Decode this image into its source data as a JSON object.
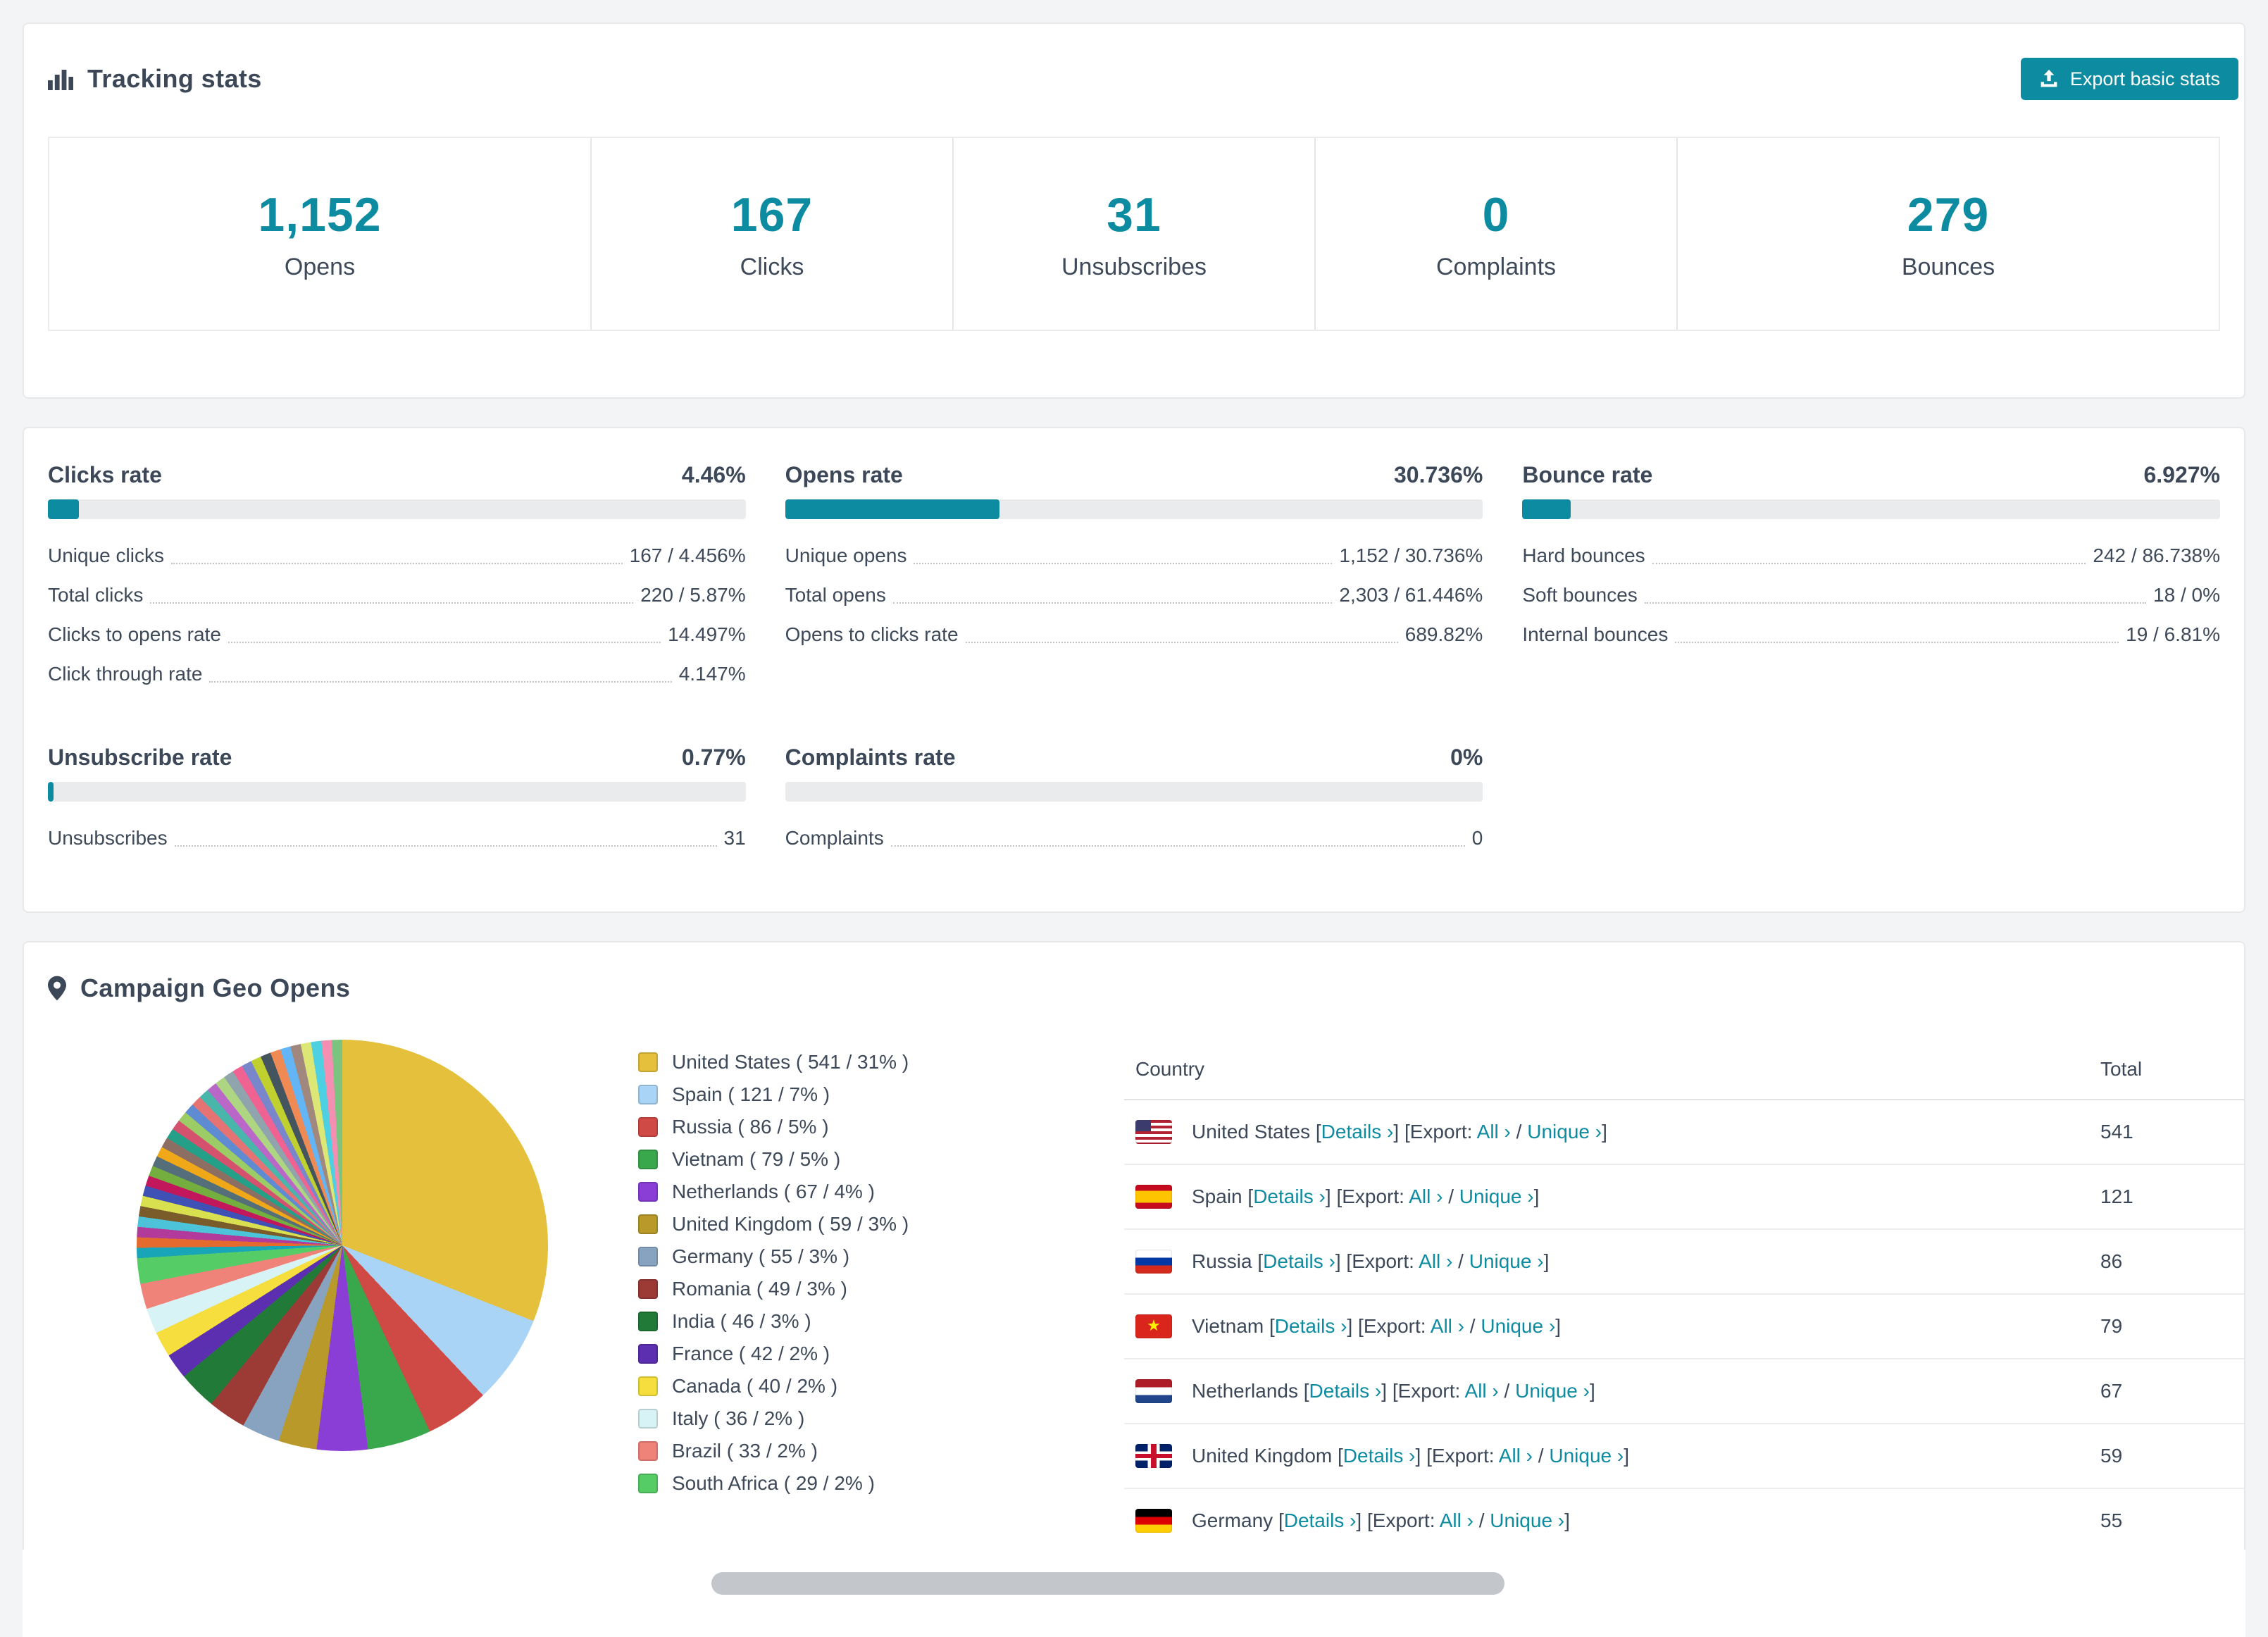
{
  "accent": "#0d8ba1",
  "tracking": {
    "title": "Tracking stats",
    "export_button": "Export basic stats",
    "metrics": [
      {
        "value": "1,152",
        "label": "Opens"
      },
      {
        "value": "167",
        "label": "Clicks"
      },
      {
        "value": "31",
        "label": "Unsubscribes"
      },
      {
        "value": "0",
        "label": "Complaints"
      },
      {
        "value": "279",
        "label": "Bounces"
      }
    ]
  },
  "rates": [
    {
      "title": "Clicks rate",
      "value": "4.46%",
      "fill": "4.46%",
      "rows": [
        {
          "label": "Unique clicks",
          "value": "167 / 4.456%"
        },
        {
          "label": "Total clicks",
          "value": "220 / 5.87%"
        },
        {
          "label": "Clicks to opens rate",
          "value": "14.497%"
        },
        {
          "label": "Click through rate",
          "value": "4.147%"
        }
      ]
    },
    {
      "title": "Opens rate",
      "value": "30.736%",
      "fill": "30.736%",
      "rows": [
        {
          "label": "Unique opens",
          "value": "1,152 / 30.736%"
        },
        {
          "label": "Total opens",
          "value": "2,303 / 61.446%"
        },
        {
          "label": "Opens to clicks rate",
          "value": "689.82%"
        }
      ]
    },
    {
      "title": "Bounce rate",
      "value": "6.927%",
      "fill": "6.927%",
      "rows": [
        {
          "label": "Hard bounces",
          "value": "242 / 86.738%"
        },
        {
          "label": "Soft bounces",
          "value": "18 / 0%"
        },
        {
          "label": "Internal bounces",
          "value": "19 / 6.81%"
        }
      ]
    },
    {
      "title": "Unsubscribe rate",
      "value": "0.77%",
      "fill": "0.77%",
      "rows": [
        {
          "label": "Unsubscribes",
          "value": "31"
        }
      ]
    },
    {
      "title": "Complaints rate",
      "value": "0%",
      "fill": "0%",
      "rows": [
        {
          "label": "Complaints",
          "value": "0"
        }
      ]
    }
  ],
  "geo": {
    "title": "Campaign Geo Opens",
    "chart_data": {
      "type": "pie",
      "title": "Campaign Geo Opens",
      "slices": [
        {
          "label": "United States",
          "count": 541,
          "pct": 31,
          "color": "#e4c03c"
        },
        {
          "label": "Spain",
          "count": 121,
          "pct": 7,
          "color": "#aad4f5"
        },
        {
          "label": "Russia",
          "count": 86,
          "pct": 5,
          "color": "#cf4a45"
        },
        {
          "label": "Vietnam",
          "count": 79,
          "pct": 5,
          "color": "#39a84d"
        },
        {
          "label": "Netherlands",
          "count": 67,
          "pct": 4,
          "color": "#8a3ed6"
        },
        {
          "label": "United Kingdom",
          "count": 59,
          "pct": 3,
          "color": "#b8992a"
        },
        {
          "label": "Germany",
          "count": 55,
          "pct": 3,
          "color": "#87a3c0"
        },
        {
          "label": "Romania",
          "count": 49,
          "pct": 3,
          "color": "#9c3b35"
        },
        {
          "label": "India",
          "count": 46,
          "pct": 3,
          "color": "#227a39"
        },
        {
          "label": "France",
          "count": 42,
          "pct": 2,
          "color": "#5b2fb0"
        },
        {
          "label": "Canada",
          "count": 40,
          "pct": 2,
          "color": "#f5de3d"
        },
        {
          "label": "Italy",
          "count": 36,
          "pct": 2,
          "color": "#d8f3f5"
        },
        {
          "label": "Brazil",
          "count": 33,
          "pct": 2,
          "color": "#f08379"
        },
        {
          "label": "South Africa",
          "count": 29,
          "pct": 2,
          "color": "#55cc66"
        }
      ],
      "other": {
        "pct_total": 26,
        "colors": [
          "#18a5b8",
          "#e46a2e",
          "#b23a9b",
          "#4cc3d9",
          "#7a5c2b",
          "#d9e04f",
          "#3f51b5",
          "#c2185b",
          "#74ae3f",
          "#546e7a",
          "#f0a818",
          "#8d6e63",
          "#24a089",
          "#d4526e",
          "#9ccc65",
          "#5e8bd1",
          "#e57373",
          "#49b6ac",
          "#ba68c8",
          "#aed581",
          "#90a4ae",
          "#f06292",
          "#7986cb",
          "#c0d12f",
          "#45555f",
          "#f08a55",
          "#64b5f6",
          "#a1887f",
          "#dce775",
          "#4dd0e1",
          "#f48fb1",
          "#7bc47f"
        ]
      }
    },
    "legend": [
      {
        "text": "United States ( 541 / 31% )",
        "color": "#e4c03c"
      },
      {
        "text": "Spain ( 121 / 7% )",
        "color": "#aad4f5"
      },
      {
        "text": "Russia ( 86 / 5% )",
        "color": "#cf4a45"
      },
      {
        "text": "Vietnam ( 79 / 5% )",
        "color": "#39a84d"
      },
      {
        "text": "Netherlands ( 67 / 4% )",
        "color": "#8a3ed6"
      },
      {
        "text": "United Kingdom ( 59 / 3% )",
        "color": "#b8992a"
      },
      {
        "text": "Germany ( 55 / 3% )",
        "color": "#87a3c0"
      },
      {
        "text": "Romania ( 49 / 3% )",
        "color": "#9c3b35"
      },
      {
        "text": "India ( 46 / 3% )",
        "color": "#227a39"
      },
      {
        "text": "France ( 42 / 2% )",
        "color": "#5b2fb0"
      },
      {
        "text": "Canada ( 40 / 2% )",
        "color": "#f5de3d"
      },
      {
        "text": "Italy ( 36 / 2% )",
        "color": "#d8f3f5"
      },
      {
        "text": "Brazil ( 33 / 2% )",
        "color": "#f08379"
      },
      {
        "text": "South Africa ( 29 / 2% )",
        "color": "#55cc66"
      }
    ],
    "table": {
      "headers": [
        "Country",
        "Total"
      ],
      "labels": {
        "open_bracket": "[",
        "close_bracket": "]",
        "details": "Details ›",
        "export_prefix": "[Export:",
        "all": "All ›",
        "slash": "/",
        "unique": "Unique ›"
      },
      "rows": [
        {
          "country": "United States",
          "total": "541",
          "flag": "us"
        },
        {
          "country": "Spain",
          "total": "121",
          "flag": "es"
        },
        {
          "country": "Russia",
          "total": "86",
          "flag": "ru"
        },
        {
          "country": "Vietnam",
          "total": "79",
          "flag": "vn"
        },
        {
          "country": "Netherlands",
          "total": "67",
          "flag": "nl"
        },
        {
          "country": "United Kingdom",
          "total": "59",
          "flag": "gb"
        },
        {
          "country": "Germany",
          "total": "55",
          "flag": "de"
        }
      ]
    }
  }
}
